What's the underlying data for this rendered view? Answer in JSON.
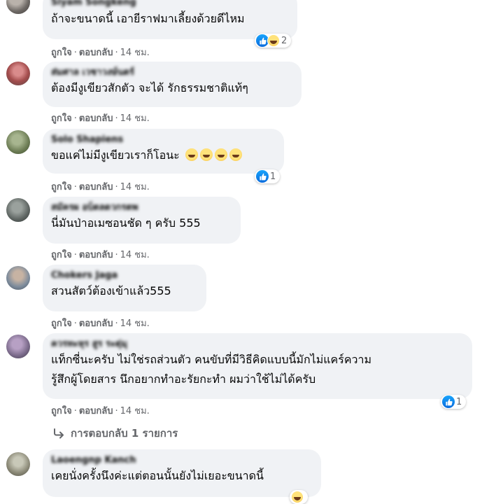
{
  "comments": [
    {
      "name": "Siyam Songkeng",
      "text": "ถ้าจะขนาดนี้ เอายีราฟมาเลี้ยงด้วยดีไหม",
      "reaction_count": "2",
      "like": "ถูกใจ",
      "reply": "ตอบกลับ",
      "time": "14 ชม."
    },
    {
      "name": "ส่มศาล เวชาวงษ์นตร์",
      "text": "ต้องมีงูเขียวสักตัว จะได้ รักธรรมชาติแท้ๆ",
      "like": "ถูกใจ",
      "reply": "ตอบกลับ",
      "time": "14 ชม."
    },
    {
      "name": "Solo Shapiens",
      "text": "ขอแค่ไม่มีงูเขียวเราก็โอนะ",
      "reaction_count": "1",
      "like": "ถูกใจ",
      "reply": "ตอบกลับ",
      "time": "14 ชม."
    },
    {
      "name": "สมัครผ อบ็ตลดวกรตพ",
      "text": "นี่มันป่าอเมซอนชัด ๆ ครับ 555",
      "like": "ถูกใจ",
      "reply": "ตอบกลับ",
      "time": "14 ชม."
    },
    {
      "name": "Chokers Jaga",
      "text": "สวนสัตว์ต้องเข้าแล้ว555",
      "like": "ถูกใจ",
      "reply": "ตอบกลับ",
      "time": "14 ชม."
    },
    {
      "name": "ควรทะหุร สูร ระดุ่มุ",
      "text": "แท็กซี่นะครับ ไม่ใช่รถส่วนตัว คนขับที่มีวิธีคิดแบบนี้มักไม่แคร์ความ\nรู้สึกผู้โดยสาร นึกอยากทำอะรัยกะทำ ผมว่าใช้ไม่ได้ครับ",
      "reaction_count": "1",
      "like": "ถูกใจ",
      "reply": "ตอบกลับ",
      "time": "14 ชม.",
      "replies_label": "การตอบกลับ 1 รายการ"
    },
    {
      "name": "Laoengnp Kanch",
      "text": "เคยนั่งครั้งนึงค่ะแต่ตอนนั้นยังไม่เยอะขนาดนี้"
    }
  ],
  "colors": {
    "bubble": "#f0f2f5",
    "secondary_text": "#65676b",
    "like_blue": "#1877f2"
  },
  "icons": [
    "like-icon",
    "haha-icon",
    "emoji-grin-icon",
    "reply-arrow-icon"
  ]
}
